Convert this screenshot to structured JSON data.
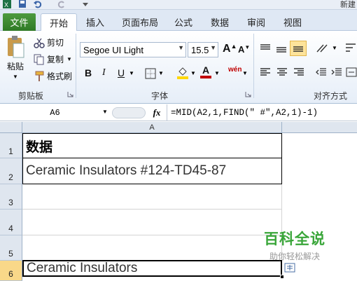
{
  "window": {
    "title": "新建"
  },
  "tabs": [
    {
      "label": "文件"
    },
    {
      "label": "开始"
    },
    {
      "label": "插入"
    },
    {
      "label": "页面布局"
    },
    {
      "label": "公式"
    },
    {
      "label": "数据"
    },
    {
      "label": "审阅"
    },
    {
      "label": "视图"
    }
  ],
  "ribbon": {
    "clipboard": {
      "paste": "粘贴",
      "cut": "剪切",
      "copy": "复制",
      "format_painter": "格式刷",
      "group_label": "剪贴板"
    },
    "font": {
      "font_name": "Segoe UI Light",
      "font_size": "15.5",
      "group_label": "字体",
      "bold": "B",
      "italic": "I",
      "underline": "U",
      "grow": "A",
      "shrink": "A",
      "font_color": "A",
      "phonetic": "wén"
    },
    "alignment": {
      "group_label": "对齐方式"
    }
  },
  "formula_bar": {
    "name_box": "A6",
    "fx": "fx",
    "formula": "=MID(A2,1,FIND(\" #\",A2,1)-1)"
  },
  "sheet": {
    "column_header": "A",
    "rows": [
      {
        "num": "1",
        "value": "数据"
      },
      {
        "num": "2",
        "value": "Ceramic Insulators #124-TD45-87"
      },
      {
        "num": "3",
        "value": ""
      },
      {
        "num": "4",
        "value": ""
      },
      {
        "num": "5",
        "value": ""
      },
      {
        "num": "6",
        "value": "Ceramic Insulators"
      }
    ]
  },
  "watermark": {
    "title": "百科全说",
    "subtitle": "助你轻松解决"
  },
  "colors": {
    "file_tab": "#2f7a26",
    "accent_red": "#c00000",
    "highlight_yellow": "#ffd700",
    "watermark_green": "#3aa63a"
  }
}
